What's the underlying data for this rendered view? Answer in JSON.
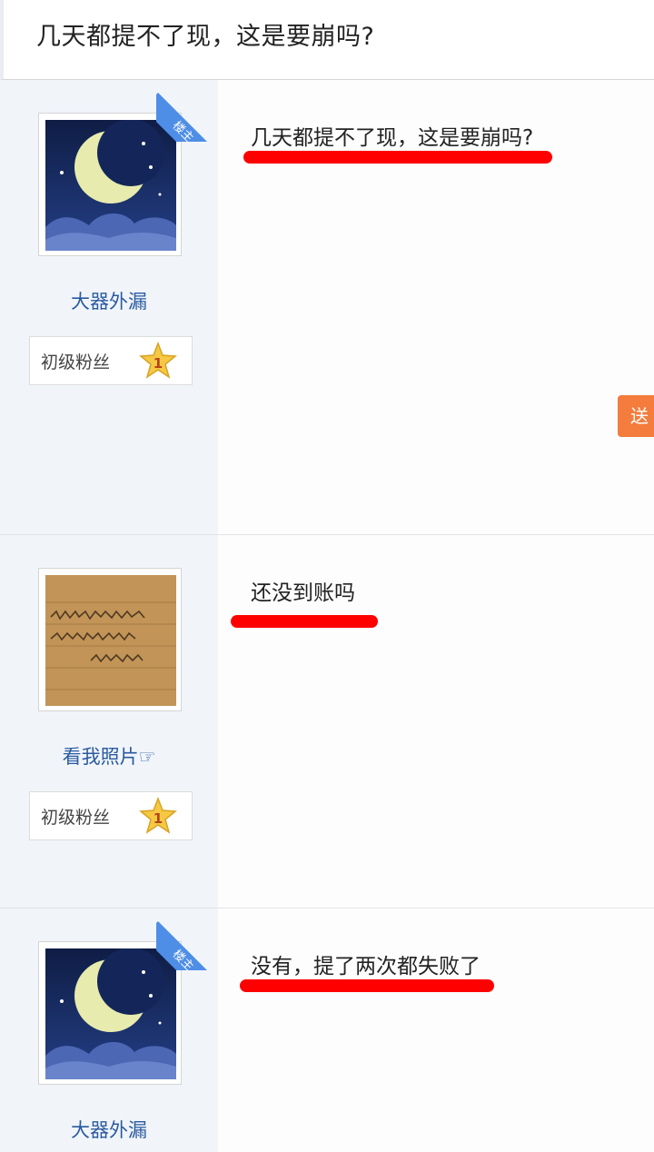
{
  "header": {
    "title": "几天都提不了现，这是要崩吗?"
  },
  "posts": [
    {
      "username": "大器外漏",
      "badge_label": "初级粉丝",
      "badge_level": "1",
      "ribbon": "楼主",
      "content": "几天都提不了现，这是要崩吗?",
      "gift_label": "送"
    },
    {
      "username": "看我照片☞",
      "badge_label": "初级粉丝",
      "badge_level": "1",
      "content": "还没到账吗"
    },
    {
      "username": "大器外漏",
      "ribbon": "楼主",
      "content": "没有，提了两次都失败了"
    }
  ],
  "colors": {
    "username": "#2a5aa0",
    "ribbon": "#4e8ee6",
    "underline": "#ff0000",
    "gift": "#f47c3c"
  }
}
